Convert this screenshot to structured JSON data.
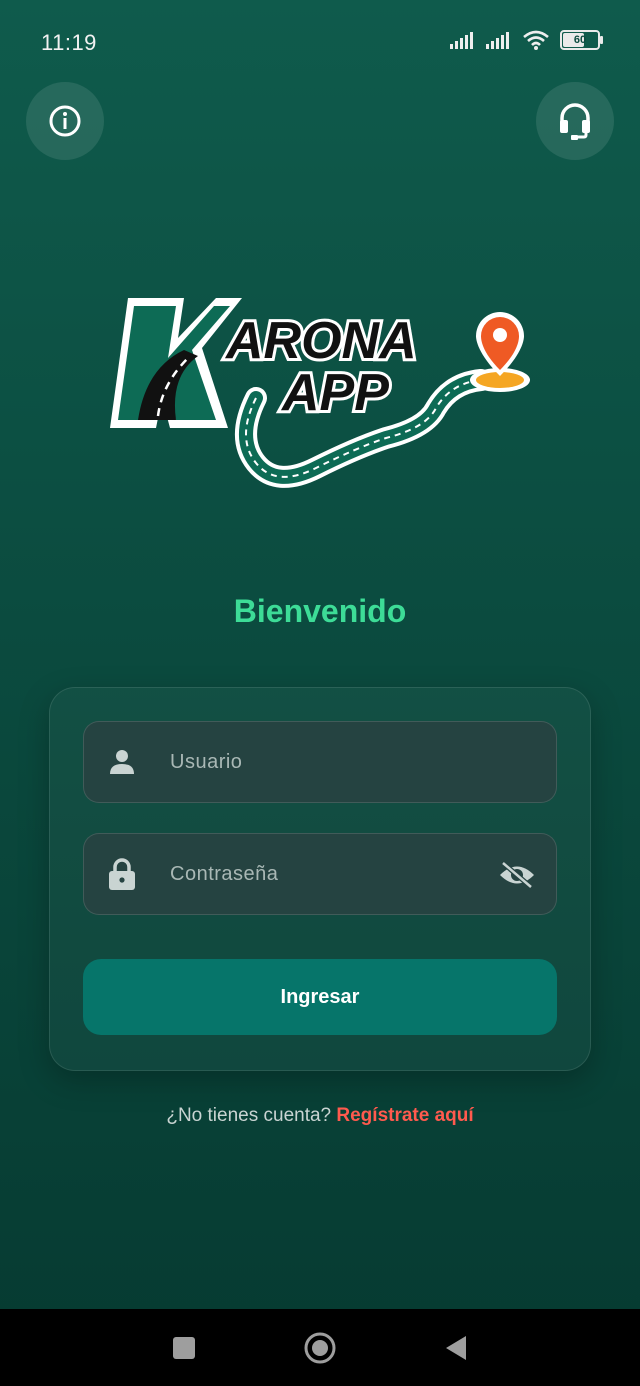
{
  "status_bar": {
    "time": "11:19",
    "battery": "60"
  },
  "logo": {
    "line1_rest": "ARONA",
    "line2": "APP",
    "initial": "K"
  },
  "welcome": "Bienvenido",
  "form": {
    "username_placeholder": "Usuario",
    "password_placeholder": "Contraseña",
    "submit_label": "Ingresar"
  },
  "register": {
    "question": "¿No tienes cuenta?",
    "link": "Regístrate aquí"
  },
  "colors": {
    "accent_green": "#3ddc97",
    "button": "#06756a",
    "link": "#ff5a4e"
  },
  "icons": [
    "info-icon",
    "headset-icon",
    "user-icon",
    "lock-icon",
    "eye-off-icon"
  ]
}
